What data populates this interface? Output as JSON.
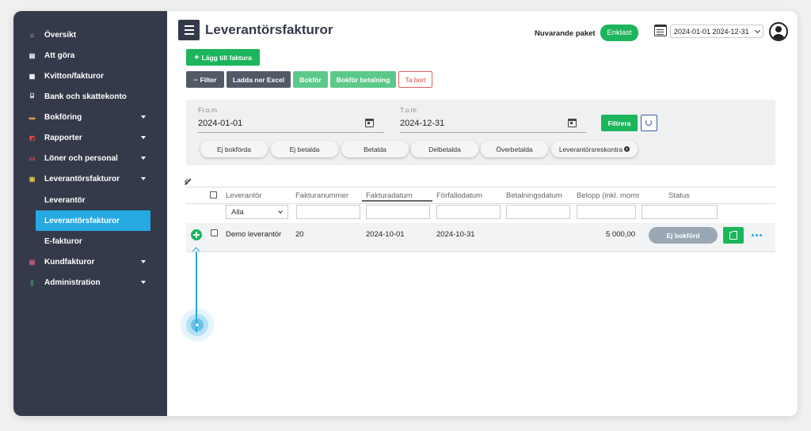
{
  "sidebar": {
    "items": [
      {
        "label": "Översikt",
        "icon": "home-icon",
        "icon_glyph": "⌂",
        "chevron": false
      },
      {
        "label": "Att göra",
        "icon": "list-icon",
        "icon_glyph": "▤",
        "chevron": false
      },
      {
        "label": "Kvitton/fakturor",
        "icon": "document-icon",
        "icon_glyph": "▦",
        "chevron": false
      },
      {
        "label": "Bank och skattekonto",
        "icon": "bank-icon",
        "icon_glyph": "⌸",
        "chevron": false
      },
      {
        "label": "Bokföring",
        "icon": "ledger-icon",
        "icon_glyph": "▬",
        "chevron": true
      },
      {
        "label": "Rapporter",
        "icon": "report-icon",
        "icon_glyph": "◩",
        "chevron": true
      },
      {
        "label": "Löner och personal",
        "icon": "card-icon",
        "icon_glyph": "▭",
        "chevron": true
      },
      {
        "label": "Leverantörsfakturor",
        "icon": "supplier-invoice-icon",
        "icon_glyph": "▣",
        "chevron": true
      },
      {
        "label": "Leverantör",
        "sub": true
      },
      {
        "label": "Leverantörsfakturor",
        "sub": true,
        "active": true
      },
      {
        "label": "E-fakturor",
        "sub": true
      },
      {
        "label": "Kundfakturor",
        "icon": "customer-invoice-icon",
        "icon_glyph": "▤",
        "chevron": true
      },
      {
        "label": "Administration",
        "icon": "admin-icon",
        "icon_glyph": "▯",
        "chevron": true
      }
    ]
  },
  "header": {
    "title": "Leverantörsfakturor",
    "package_label": "Nuvarande paket",
    "package_value": "Enklast",
    "period": "2024-01-01 2024-12-31"
  },
  "toolbar": {
    "add_invoice": "Lägg till faktura",
    "filter": "Filter",
    "download_excel": "Ladda ner Excel",
    "book": "Bokför",
    "book_payment": "Bokför betalning",
    "delete": "Ta bort"
  },
  "filters": {
    "from_label": "Fr.o.m",
    "from_value": "2024-01-01",
    "to_label": "T.o.m",
    "to_value": "2024-12-31",
    "apply": "Filtrera",
    "chips": [
      "Ej bokförda",
      "Ej betalda",
      "Betalda",
      "Delbetalda",
      "Överbetalda",
      "Leverantörsreskontra"
    ]
  },
  "table": {
    "columns": [
      "Leverantör",
      "Fakturanummer",
      "Fakturadatum",
      "Förfallodatum",
      "Betalningsdatum",
      "Belopp (inkl. moms)",
      "Status"
    ],
    "supplier_filter": "Alla",
    "rows": [
      {
        "supplier": "Demo leverantör",
        "invoice_number": "20",
        "invoice_date": "2024-10-01",
        "due_date": "2024-10-31",
        "payment_date": "",
        "amount": "5 000,00",
        "status": "Ej bokförd"
      }
    ]
  },
  "colors": {
    "sidebar_bg": "#343a4a",
    "accent_blue": "#27a9e1",
    "brand_green": "#1bb55c"
  }
}
